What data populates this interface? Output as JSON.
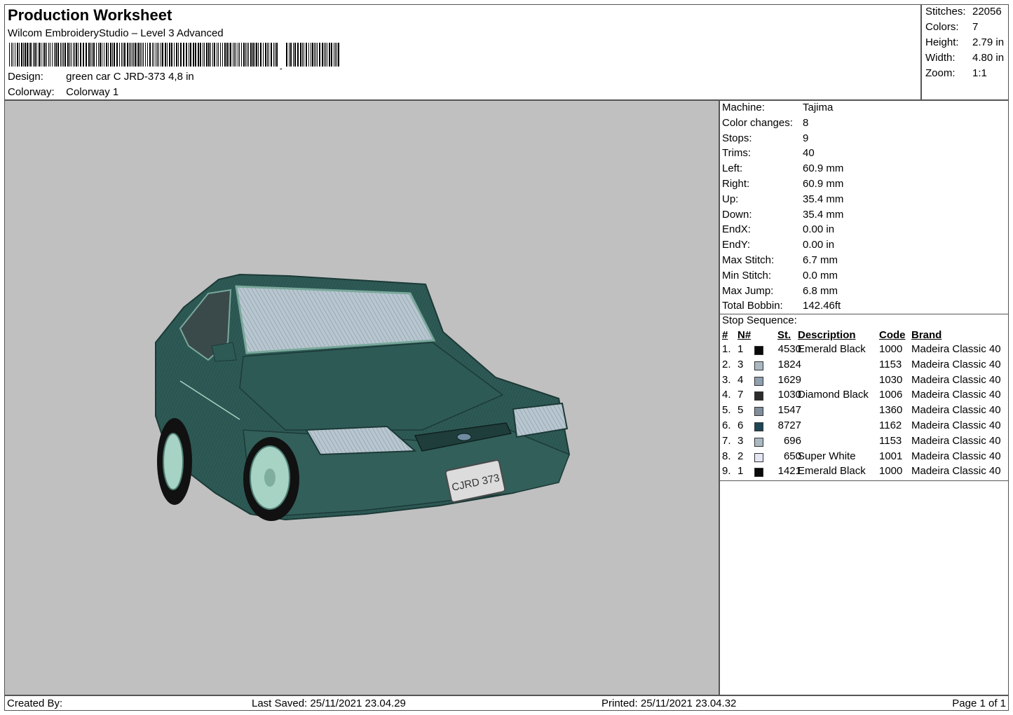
{
  "header": {
    "title": "Production Worksheet",
    "software": "Wilcom EmbroideryStudio – Level 3 Advanced",
    "design_label": "Design:",
    "design_value": "green car C JRD-373 4,8 in",
    "colorway_label": "Colorway:",
    "colorway_value": "Colorway 1"
  },
  "summary": [
    {
      "label": "Stitches:",
      "value": "22056"
    },
    {
      "label": "Colors:",
      "value": "7"
    },
    {
      "label": "Height:",
      "value": "2.79 in"
    },
    {
      "label": "Width:",
      "value": "4.80 in"
    },
    {
      "label": "Zoom:",
      "value": "1:1"
    }
  ],
  "machine_info": [
    {
      "label": "Machine:",
      "value": "Tajima"
    },
    {
      "label": "Color changes:",
      "value": "8"
    },
    {
      "label": "Stops:",
      "value": "9"
    },
    {
      "label": "Trims:",
      "value": "40"
    },
    {
      "label": "Left:",
      "value": "60.9 mm"
    },
    {
      "label": "Right:",
      "value": "60.9 mm"
    },
    {
      "label": "Up:",
      "value": "35.4 mm"
    },
    {
      "label": "Down:",
      "value": "35.4 mm"
    },
    {
      "label": "EndX:",
      "value": "0.00 in"
    },
    {
      "label": "EndY:",
      "value": "0.00 in"
    },
    {
      "label": "Max Stitch:",
      "value": "6.7 mm"
    },
    {
      "label": "Min Stitch:",
      "value": "0.0 mm"
    },
    {
      "label": "Max Jump:",
      "value": "6.8 mm"
    },
    {
      "label": "Total Bobbin:",
      "value": "142.46ft"
    }
  ],
  "stop_sequence": {
    "title": "Stop Sequence:",
    "columns": {
      "idx": "#",
      "n": "N#",
      "st": "St.",
      "desc": "Description",
      "code": "Code",
      "brand": "Brand"
    },
    "rows": [
      {
        "idx": "1.",
        "n": "1",
        "color": "#0a0a0a",
        "st": "4530",
        "desc": "Emerald Black",
        "code": "1000",
        "brand": "Madeira Classic 40"
      },
      {
        "idx": "2.",
        "n": "3",
        "color": "#aab8c2",
        "st": "1824",
        "desc": "",
        "code": "1153",
        "brand": "Madeira Classic 40"
      },
      {
        "idx": "3.",
        "n": "4",
        "color": "#8fa0b0",
        "st": "1629",
        "desc": "",
        "code": "1030",
        "brand": "Madeira Classic 40"
      },
      {
        "idx": "4.",
        "n": "7",
        "color": "#2c2c2c",
        "st": "1030",
        "desc": "Diamond Black",
        "code": "1006",
        "brand": "Madeira Classic 40"
      },
      {
        "idx": "5.",
        "n": "5",
        "color": "#7f8e9a",
        "st": "1547",
        "desc": "",
        "code": "1360",
        "brand": "Madeira Classic 40"
      },
      {
        "idx": "6.",
        "n": "6",
        "color": "#1f4654",
        "st": "8727",
        "desc": "",
        "code": "1162",
        "brand": "Madeira Classic 40"
      },
      {
        "idx": "7.",
        "n": "3",
        "color": "#aab8c2",
        "st": "696",
        "desc": "",
        "code": "1153",
        "brand": "Madeira Classic 40"
      },
      {
        "idx": "8.",
        "n": "2",
        "color": "#e4e6f4",
        "st": "650",
        "desc": "Super White",
        "code": "1001",
        "brand": "Madeira Classic 40"
      },
      {
        "idx": "9.",
        "n": "1",
        "color": "#0a0a0a",
        "st": "1421",
        "desc": "Emerald Black",
        "code": "1000",
        "brand": "Madeira Classic 40"
      }
    ]
  },
  "preview": {
    "plate_text": "CJRD 373",
    "body_color": "#2e5a56",
    "accent_color": "#a7d3c4"
  },
  "footer": {
    "created_by": "Created By:",
    "last_saved": "Last Saved: 25/11/2021 23.04.29",
    "printed": "Printed: 25/11/2021 23.04.32",
    "page": "Page 1 of 1"
  }
}
